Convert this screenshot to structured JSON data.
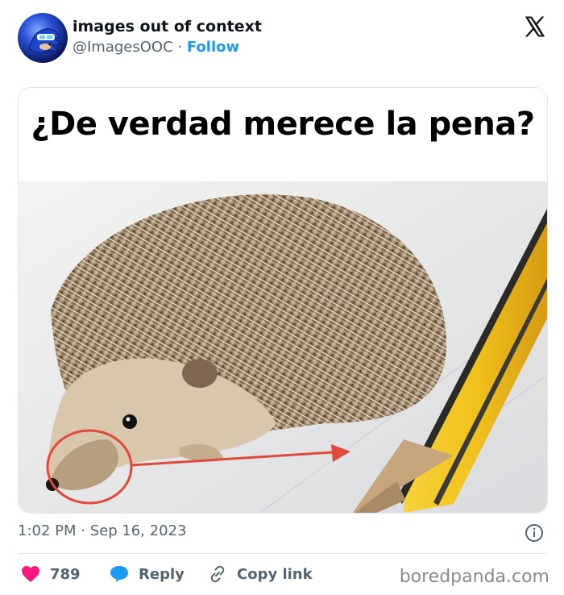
{
  "tweet": {
    "author_name": "images out of context",
    "handle": "@ImagesOOC",
    "separator": "·",
    "follow_label": "Follow",
    "image_caption": "¿De verdad merece la pena?",
    "timestamp": "1:02 PM · Sep 16, 2023"
  },
  "actions": {
    "like_count": "789",
    "reply_label": "Reply",
    "copy_link_label": "Copy link"
  },
  "watermark": "boredpanda.com",
  "icons": [
    "x-logo-icon",
    "info-icon",
    "heart-icon",
    "reply-bubble-icon",
    "link-icon"
  ],
  "colors": {
    "accent": "#1d9bf0",
    "like": "#f91880",
    "muted": "#536471"
  }
}
